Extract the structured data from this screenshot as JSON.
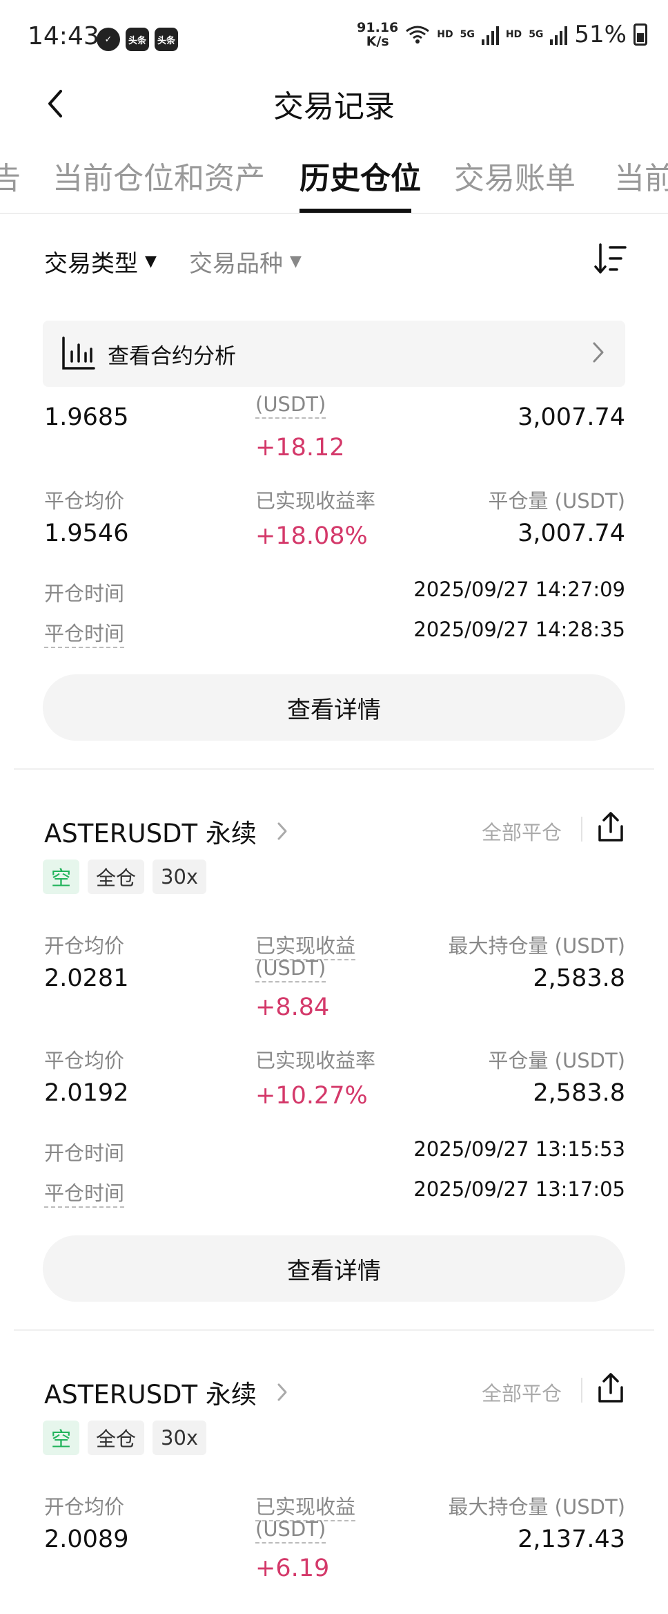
{
  "status_bar": {
    "time": "14:43",
    "app_icon_1": "✓",
    "app_icon_2": "头条",
    "app_icon_3": "头条",
    "net_speed_value": "91.16",
    "net_speed_unit": "K/s",
    "hd_1": "HD",
    "net_1": "5G",
    "hd_2": "HD",
    "net_2": "5G",
    "battery": "51%"
  },
  "nav": {
    "back": "‹",
    "title": "交易记录"
  },
  "tabs": [
    {
      "label": "告"
    },
    {
      "label": "当前仓位和资产"
    },
    {
      "label": "历史仓位"
    },
    {
      "label": "交易账单"
    },
    {
      "label": "当前"
    }
  ],
  "filters": {
    "trade_type": "交易类型",
    "instrument": "交易品种",
    "caret": "▼"
  },
  "analysis": {
    "label": "查看合约分析"
  },
  "cards": [
    {
      "open_avg_value": "1.9685",
      "realized_pnl_label_unit": "(USDT)",
      "realized_pnl": "+18.12",
      "max_pos_value": "3,007.74",
      "close_avg_label": "平仓均价",
      "close_avg_value": "1.9546",
      "pnl_rate_label": "已实现收益率",
      "pnl_rate": "+18.08%",
      "close_amount_label": "平仓量 (USDT)",
      "close_amount": "3,007.74",
      "open_time_label": "开仓时间",
      "open_time": "2025/09/27 14:27:09",
      "close_time_label": "平仓时间",
      "close_time": "2025/09/27 14:28:35",
      "detail_button": "查看详情"
    },
    {
      "symbol": "ASTERUSDT 永续",
      "close_all": "全部平仓",
      "tags": [
        "空",
        "全仓",
        "30x"
      ],
      "open_avg_label": "开仓均价",
      "open_avg_value": "2.0281",
      "realized_pnl_label": "已实现收益",
      "realized_pnl_label_unit": "(USDT)",
      "realized_pnl": "+8.84",
      "max_pos_label": "最大持仓量 (USDT)",
      "max_pos_value": "2,583.8",
      "close_avg_label": "平仓均价",
      "close_avg_value": "2.0192",
      "pnl_rate_label": "已实现收益率",
      "pnl_rate": "+10.27%",
      "close_amount_label": "平仓量 (USDT)",
      "close_amount": "2,583.8",
      "open_time_label": "开仓时间",
      "open_time": "2025/09/27 13:15:53",
      "close_time_label": "平仓时间",
      "close_time": "2025/09/27 13:17:05",
      "detail_button": "查看详情"
    },
    {
      "symbol": "ASTERUSDT 永续",
      "close_all": "全部平仓",
      "tags": [
        "空",
        "全仓",
        "30x"
      ],
      "open_avg_label": "开仓均价",
      "open_avg_value": "2.0089",
      "realized_pnl_label": "已实现收益",
      "realized_pnl_label_unit": "(USDT)",
      "realized_pnl": "+6.19",
      "max_pos_label": "最大持仓量 (USDT)",
      "max_pos_value": "2,137.43"
    }
  ],
  "colors": {
    "profit": "#d4396a",
    "short": "#20b35a",
    "muted": "#888888"
  }
}
